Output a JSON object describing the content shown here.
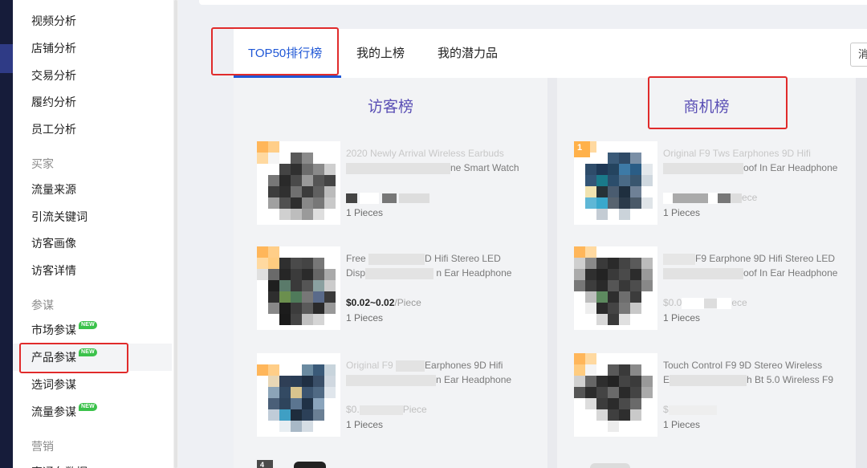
{
  "sidebar": {
    "items_top": [
      {
        "label": "视频分析"
      },
      {
        "label": "店铺分析"
      },
      {
        "label": "交易分析"
      },
      {
        "label": "履约分析"
      },
      {
        "label": "员工分析"
      }
    ],
    "group_buyer": "买家",
    "items_buyer": [
      {
        "label": "流量来源"
      },
      {
        "label": "引流关键词"
      },
      {
        "label": "访客画像"
      },
      {
        "label": "访客详情"
      }
    ],
    "group_advisor": "参谋",
    "items_advisor": [
      {
        "label": "市场参谋",
        "badge": "NEW"
      },
      {
        "label": "产品参谋",
        "badge": "NEW"
      },
      {
        "label": "选词参谋"
      },
      {
        "label": "流量参谋",
        "badge": "NEW"
      }
    ],
    "group_marketing": "营销",
    "item_marketing_partial": "直通车数据"
  },
  "tabs": [
    {
      "label": "TOP50排行榜"
    },
    {
      "label": "我的上榜"
    },
    {
      "label": "我的潜力品"
    }
  ],
  "select_partial": "消",
  "colors": {
    "accent": "#1f57d6",
    "panel_title": "#5a4fb5",
    "highlight": "#e02b2b",
    "new_badge": "#3bc24b"
  },
  "visitor_panel": {
    "title": "访客榜",
    "products": [
      {
        "title_line1": "2020 Newly Arrival Wireless Earbuds",
        "title_line2": "ne Smart Watch",
        "price": "",
        "moq": "1 Pieces"
      },
      {
        "title_line1": "Free",
        "title_line1b": "D Hifi Stereo LED",
        "title_line2a": "Disp",
        "title_line2": "n Ear Headphone",
        "price": "$0.02~0.02",
        "price_unit": "/Piece",
        "moq": "1 Pieces"
      },
      {
        "title_line1": "Original F9",
        "title_line1b": "Earphones 9D Hifi",
        "title_line2": "n Ear Headphone",
        "price": "$0.",
        "price_unit": "Piece",
        "moq": "1 Pieces"
      }
    ],
    "partial_rank": "4"
  },
  "opportunity_panel": {
    "title": "商机榜",
    "products": [
      {
        "rank": "1",
        "title_line1": "Original F9 Tws Earphones 9D Hifi",
        "title_line2": "oof In Ear Headphone",
        "price_unit": "ece",
        "moq": "1 Pieces"
      },
      {
        "title_line1": "F9 Earphone 9D Hifi Stereo LED",
        "title_line2": "oof In Ear Headphone",
        "price": "$0.0",
        "price_unit": "ece",
        "moq": "1 Pieces"
      },
      {
        "title_line1": "Touch Control F9 9D Stereo Wireless",
        "title_line2a": "E",
        "title_line2": "h Bt 5.0 Wireless F9",
        "price": "$",
        "moq": "1 Pieces"
      }
    ]
  }
}
